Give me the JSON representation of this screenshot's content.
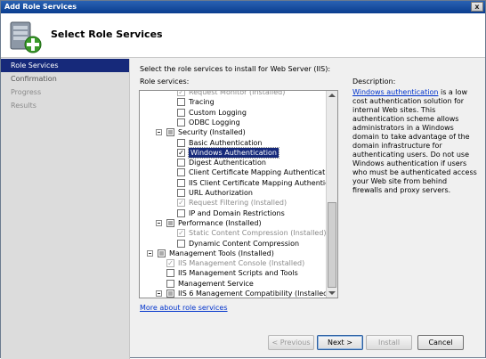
{
  "window": {
    "title": "Add Role Services",
    "close_glyph": "x"
  },
  "header": {
    "title": "Select Role Services",
    "icon": "server-add-icon"
  },
  "sidebar": {
    "items": [
      {
        "label": "Role Services",
        "state": "active"
      },
      {
        "label": "Confirmation",
        "state": "normal"
      },
      {
        "label": "Progress",
        "state": "dim"
      },
      {
        "label": "Results",
        "state": "dim"
      }
    ]
  },
  "content": {
    "instruction": "Select the role services to install for Web Server (IIS):",
    "role_services_label": "Role services:",
    "more_link": "More about role services"
  },
  "tree": [
    {
      "label": "Request Monitor  (Installed)",
      "level": 3,
      "checked": true,
      "disabled": true
    },
    {
      "label": "Tracing",
      "level": 3,
      "checked": false,
      "disabled": false
    },
    {
      "label": "Custom Logging",
      "level": 3,
      "checked": false,
      "disabled": false
    },
    {
      "label": "ODBC Logging",
      "level": 3,
      "checked": false,
      "disabled": false
    },
    {
      "label": "Security  (Installed)",
      "level": 2,
      "checked": "mixed",
      "disabled": false,
      "expander": true
    },
    {
      "label": "Basic Authentication",
      "level": 3,
      "checked": false,
      "disabled": false
    },
    {
      "label": "Windows Authentication",
      "level": 3,
      "checked": true,
      "disabled": false,
      "selected": true
    },
    {
      "label": "Digest Authentication",
      "level": 3,
      "checked": false,
      "disabled": false
    },
    {
      "label": "Client Certificate Mapping Authentication",
      "level": 3,
      "checked": false,
      "disabled": false
    },
    {
      "label": "IIS Client Certificate Mapping Authentication",
      "level": 3,
      "checked": false,
      "disabled": false
    },
    {
      "label": "URL Authorization",
      "level": 3,
      "checked": false,
      "disabled": false
    },
    {
      "label": "Request Filtering  (Installed)",
      "level": 3,
      "checked": true,
      "disabled": true
    },
    {
      "label": "IP and Domain Restrictions",
      "level": 3,
      "checked": false,
      "disabled": false
    },
    {
      "label": "Performance  (Installed)",
      "level": 2,
      "checked": "mixed",
      "disabled": false,
      "expander": true
    },
    {
      "label": "Static Content Compression  (Installed)",
      "level": 3,
      "checked": true,
      "disabled": true
    },
    {
      "label": "Dynamic Content Compression",
      "level": 3,
      "checked": false,
      "disabled": false
    },
    {
      "label": "Management Tools  (Installed)",
      "level": 1,
      "checked": "mixed",
      "disabled": false,
      "expander": true
    },
    {
      "label": "IIS Management Console  (Installed)",
      "level": 2,
      "checked": true,
      "disabled": true
    },
    {
      "label": "IIS Management Scripts and Tools",
      "level": 2,
      "checked": false,
      "disabled": false
    },
    {
      "label": "Management Service",
      "level": 2,
      "checked": false,
      "disabled": false
    },
    {
      "label": "IIS 6 Management Compatibility  (Installed)",
      "level": 2,
      "checked": "mixed",
      "disabled": false,
      "expander": true
    }
  ],
  "description": {
    "heading": "Description:",
    "link_text": "Windows authentication",
    "body": " is a low cost authentication solution for internal Web sites. This authentication scheme allows administrators in a Windows domain to take advantage of the domain infrastructure for authenticating users. Do not use Windows authentication if users who must be authenticated access your Web site from behind firewalls and proxy servers."
  },
  "buttons": {
    "previous": "< Previous",
    "next": "Next >",
    "install": "Install",
    "cancel": "Cancel"
  }
}
